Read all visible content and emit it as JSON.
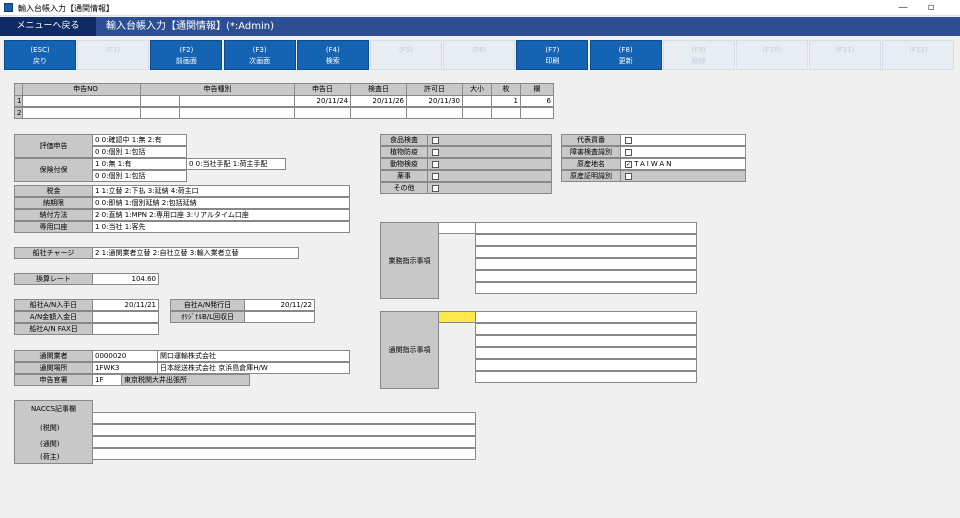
{
  "window": {
    "title": "輸入台帳入力【通関情報】",
    "minimize": "—",
    "restore": "▫"
  },
  "menu": {
    "back": "メニューへ戻る",
    "page_title": "輸入台帳入力【通関情報】(*:Admin)"
  },
  "fkeys": [
    {
      "key": "(ESC)",
      "label": "戻り",
      "enabled": true
    },
    {
      "key": "(F1)",
      "label": "",
      "enabled": false
    },
    {
      "key": "(F2)",
      "label": "前画面",
      "enabled": true
    },
    {
      "key": "(F3)",
      "label": "次画面",
      "enabled": true
    },
    {
      "key": "(F4)",
      "label": "検索",
      "enabled": true
    },
    {
      "key": "(F5)",
      "label": "",
      "enabled": false
    },
    {
      "key": "(F6)",
      "label": "",
      "enabled": false
    },
    {
      "key": "(F7)",
      "label": "印刷",
      "enabled": true
    },
    {
      "key": "(F8)",
      "label": "更新",
      "enabled": true
    },
    {
      "key": "(F9)",
      "label": "削除",
      "enabled": false
    },
    {
      "key": "(F10)",
      "label": "",
      "enabled": false
    },
    {
      "key": "(F11)",
      "label": "",
      "enabled": false
    },
    {
      "key": "(F12)",
      "label": "",
      "enabled": false
    }
  ],
  "grid": {
    "headers": [
      "申告NO",
      "申告種別",
      "申告日",
      "検査日",
      "許可日",
      "大小",
      "枚",
      "欄"
    ],
    "rows": [
      {
        "no": "1",
        "shinkoku_no": "",
        "shubetsu1": "",
        "shubetsu2": "",
        "shinkoku_bi": "20/11/24",
        "kensa_bi": "20/11/26",
        "kyoka_bi": "20/11/30",
        "daisho": "",
        "mai": "1",
        "ran": "6"
      },
      {
        "no": "2",
        "shinkoku_no": "",
        "shubetsu1": "",
        "shubetsu2": "",
        "shinkoku_bi": "",
        "kensa_bi": "",
        "kyoka_bi": "",
        "daisho": "",
        "mai": "",
        "ran": ""
      }
    ]
  },
  "left": {
    "hyoka_label": "評価申告",
    "hyoka1": "0 0:確認中 1:無 2:有",
    "hyoka2": "0 0:個別 1:包括",
    "hoken_label": "保険付保",
    "hoken1": "1 0:無 1:有",
    "hoken1b": "0 0:当社手配 1:荷主手配",
    "hoken2": "0 0:個別 1:包括",
    "zeikin_label": "税金",
    "zeikin": "1 1:立替 2:下払 3:延納 4:荷主口",
    "nokigen_label": "納期限",
    "nokigen": "0 0:即納 1:個別延納 2:包括延納",
    "nofu_label": "納付方法",
    "nofu": "2 0:直納 1:MPN 2:専用口座 3:リアルタイム口座",
    "senyo_label": "専用口座",
    "senyo": "1 0:当社 1:客先",
    "charge_label": "船社チャージ",
    "charge": "2 1:通関業者立替 2:自社立替 3:輸入業者立替",
    "rate_label": "換算レート",
    "rate": "104.60",
    "an_nyushu_label": "船社A/N入手日",
    "an_nyushu": "20/11/21",
    "an_nyukin_label": "A/N金額入金日",
    "an_nyukin": "",
    "an_fax_label": "船社A/N FAX日",
    "an_fax": "",
    "jisha_an_label": "自社A/N発行日",
    "jisha_an": "20/11/22",
    "bl_label": "ｵﾘｼﾞﾅﾙB/L回収日",
    "bl": "",
    "tsukan_gyosha_label": "通関業者",
    "tsukan_gyosha_code": "0000020",
    "tsukan_gyosha_name": "関口運輸株式会社",
    "tsukan_basho_label": "通関場所",
    "tsukan_basho_code": "1FWK3",
    "tsukan_basho_name": "日本総送株式会社 京浜島倉庫H/W",
    "kansho_label": "申告官署",
    "kansho_code": "1F",
    "kansho_name": "東京税関大井出張所",
    "naccs_label": "NACCS記事欄",
    "zeikan_label": "(税関)",
    "tsukan_label": "(通関)",
    "ninushi_label": "(荷主)"
  },
  "middle": {
    "items": [
      {
        "label": "食品検査",
        "checked": false
      },
      {
        "label": "植物防疫",
        "checked": false
      },
      {
        "label": "動物検疫",
        "checked": false
      },
      {
        "label": "薬事",
        "checked": false
      },
      {
        "label": "その他",
        "checked": false
      }
    ],
    "gyomu_label": "業務指示事項",
    "tsukan_shiji_label": "通関指示事項"
  },
  "right": {
    "daihyo_label": "代表貨番",
    "shogai_label": "障害検査識別",
    "gensanchi_label": "原産地名",
    "gensanchi": "TAIWAN",
    "gensan_shomei_label": "原産証明識別",
    "daihyo_checked": false,
    "shogai_checked": false,
    "gensanchi_checked": true,
    "gensan_shomei_checked": false,
    "check_mark": "✓"
  }
}
